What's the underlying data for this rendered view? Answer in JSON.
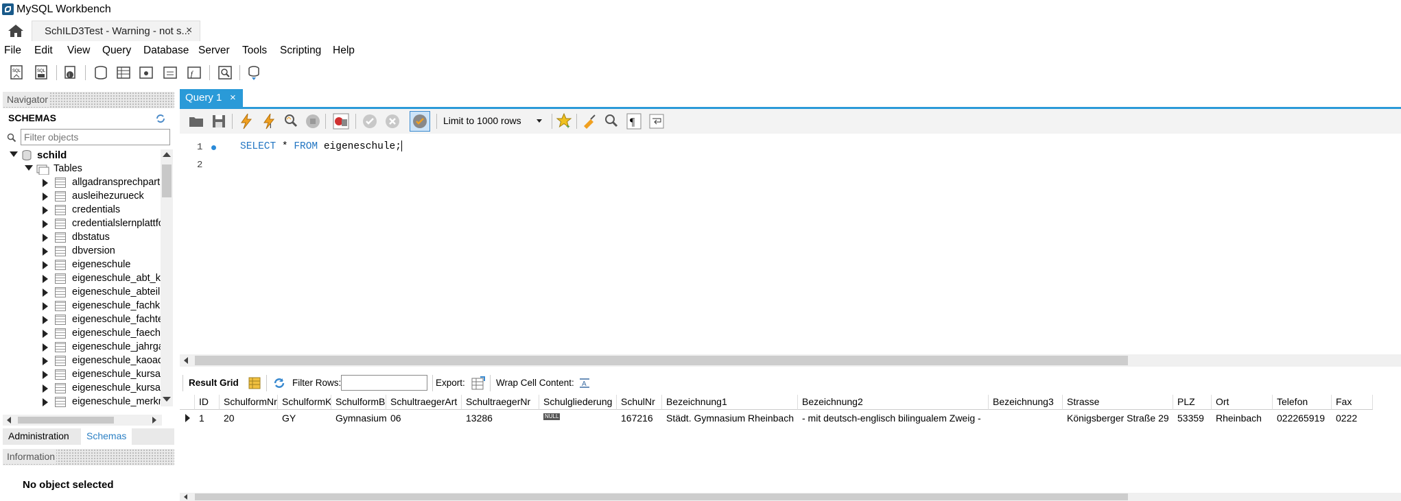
{
  "window": {
    "title": "MySQL Workbench"
  },
  "connection_tab": {
    "label": "SchILD3Test - Warning - not s...",
    "close": "×"
  },
  "menu": [
    "File",
    "Edit",
    "View",
    "Query",
    "Database",
    "Server",
    "Tools",
    "Scripting",
    "Help"
  ],
  "navigator": {
    "header": "Navigator",
    "schemas_label": "SCHEMAS",
    "filter_placeholder": "Filter objects",
    "schema": "schild",
    "tables_label": "Tables",
    "tables": [
      "allgadransprechpartn",
      "ausleihezurueck",
      "credentials",
      "credentialslernplattfo",
      "dbstatus",
      "dbversion",
      "eigeneschule",
      "eigeneschule_abt_kl",
      "eigeneschule_abteilu",
      "eigeneschule_fachkla",
      "eigeneschule_fachtei",
      "eigeneschule_faeche",
      "eigeneschule_jahrga",
      "eigeneschule_kaoad",
      "eigeneschule_kursar",
      "eigeneschule_kursar",
      "eigeneschule_merkm"
    ],
    "bottom_tabs": [
      "Administration",
      "Schemas"
    ],
    "info_header": "Information",
    "info_text": "No object selected"
  },
  "query": {
    "tab_label": "Query 1",
    "tab_close": "×",
    "limit_label": "Limit to 1000 rows",
    "lines": [
      "1",
      "2"
    ],
    "code_kw1": "SELECT",
    "code_mid": " * ",
    "code_kw2": "FROM",
    "code_rest": " eigeneschule;"
  },
  "result": {
    "grid_label": "Result Grid",
    "filter_label": "Filter Rows:",
    "export_label": "Export:",
    "wrap_label": "Wrap Cell Content:",
    "columns": [
      "ID",
      "SchulformNr",
      "SchulformKrz",
      "SchulformBez",
      "SchultraegerArt",
      "SchultraegerNr",
      "Schulgliederung",
      "SchulNr",
      "Bezeichnung1",
      "Bezeichnung2",
      "Bezeichnung3",
      "Strasse",
      "PLZ",
      "Ort",
      "Telefon",
      "Fax"
    ],
    "row": [
      "1",
      "20",
      "GY",
      "Gymnasium",
      "06",
      "13286",
      "NULL",
      "167216",
      "Städt. Gymnasium Rheinbach",
      "- mit deutsch-englisch bilingualem Zweig -",
      "",
      "Königsberger Straße 29",
      "53359",
      "Rheinbach",
      "022265919",
      "0222"
    ]
  }
}
